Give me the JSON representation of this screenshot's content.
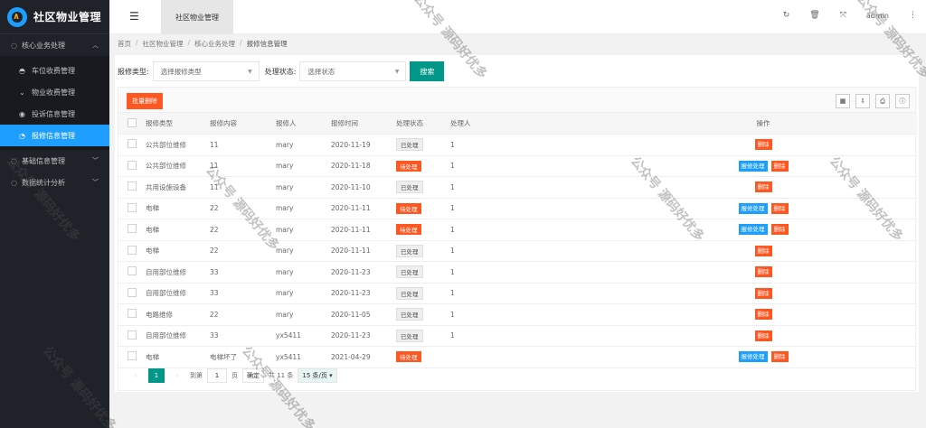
{
  "app": {
    "title": "社区物业管理"
  },
  "sidebar": {
    "groups": [
      {
        "label": "核心业务处理",
        "icon": "circle-icon",
        "expanded": true
      },
      {
        "label": "基础信息管理",
        "icon": "circle-icon",
        "expanded": false
      },
      {
        "label": "数据统计分析",
        "icon": "circle-icon",
        "expanded": false
      }
    ],
    "items": [
      {
        "label": "车位收费管理",
        "icon": "dashboard-icon"
      },
      {
        "label": "物业收费管理",
        "icon": "chevron-icon"
      },
      {
        "label": "投诉信息管理",
        "icon": "target-icon"
      },
      {
        "label": "报修信息管理",
        "icon": "clock-icon",
        "active": true
      }
    ]
  },
  "header": {
    "tab": "社区物业管理",
    "user": "admin"
  },
  "breadcrumb": [
    "首页",
    "社区物业管理",
    "核心业务处理",
    "报修信息管理"
  ],
  "filter": {
    "type_label": "报修类型:",
    "type_placeholder": "选择报修类型",
    "status_label": "处理状态:",
    "status_placeholder": "选择状态",
    "search_label": "搜索"
  },
  "toolbar": {
    "batch_delete": "批量删除"
  },
  "table": {
    "columns": [
      "报修类型",
      "报修内容",
      "报修人",
      "报修时间",
      "处理状态",
      "处理人",
      "操作"
    ],
    "rows": [
      {
        "type": "公共部位维修",
        "content": "11",
        "person": "mary",
        "time": "2020-11-19",
        "status": "已处理",
        "handler": "1",
        "ops": [
          "删除"
        ]
      },
      {
        "type": "公共部位维修",
        "content": "11",
        "person": "mary",
        "time": "2020-11-18",
        "status": "待处理",
        "handler": "1",
        "ops": [
          "报修处理",
          "删除"
        ]
      },
      {
        "type": "共用设施设备",
        "content": "11",
        "person": "mary",
        "time": "2020-11-10",
        "status": "已处理",
        "handler": "1",
        "ops": [
          "删除"
        ]
      },
      {
        "type": "电梯",
        "content": "22",
        "person": "mary",
        "time": "2020-11-11",
        "status": "待处理",
        "handler": "1",
        "ops": [
          "报修处理",
          "删除"
        ]
      },
      {
        "type": "电梯",
        "content": "22",
        "person": "mary",
        "time": "2020-11-11",
        "status": "待处理",
        "handler": "1",
        "ops": [
          "报修处理",
          "删除"
        ]
      },
      {
        "type": "电梯",
        "content": "22",
        "person": "mary",
        "time": "2020-11-11",
        "status": "已处理",
        "handler": "1",
        "ops": [
          "删除"
        ]
      },
      {
        "type": "自用部位维修",
        "content": "33",
        "person": "mary",
        "time": "2020-11-23",
        "status": "已处理",
        "handler": "1",
        "ops": [
          "删除"
        ]
      },
      {
        "type": "自用部位维修",
        "content": "33",
        "person": "mary",
        "time": "2020-11-23",
        "status": "已处理",
        "handler": "1",
        "ops": [
          "删除"
        ]
      },
      {
        "type": "电路维修",
        "content": "22",
        "person": "mary",
        "time": "2020-11-05",
        "status": "已处理",
        "handler": "1",
        "ops": [
          "删除"
        ]
      },
      {
        "type": "自用部位维修",
        "content": "33",
        "person": "yx5411",
        "time": "2020-11-23",
        "status": "已处理",
        "handler": "1",
        "ops": [
          "删除"
        ]
      },
      {
        "type": "电梯",
        "content": "电梯坏了",
        "person": "yx5411",
        "time": "2021-04-29",
        "status": "待处理",
        "handler": "",
        "ops": [
          "报修处理",
          "删除"
        ]
      }
    ]
  },
  "pager": {
    "current": "1",
    "goto_label": "到第",
    "page_input": "1",
    "page_unit": "页",
    "confirm": "确定",
    "total": "共 11 条",
    "size": "15 条/页"
  },
  "watermark": "公众号 源码好优多",
  "colors": {
    "primary": "#009688",
    "active": "#1e9fff",
    "danger": "#ff5722",
    "sidebar": "#20222a"
  }
}
